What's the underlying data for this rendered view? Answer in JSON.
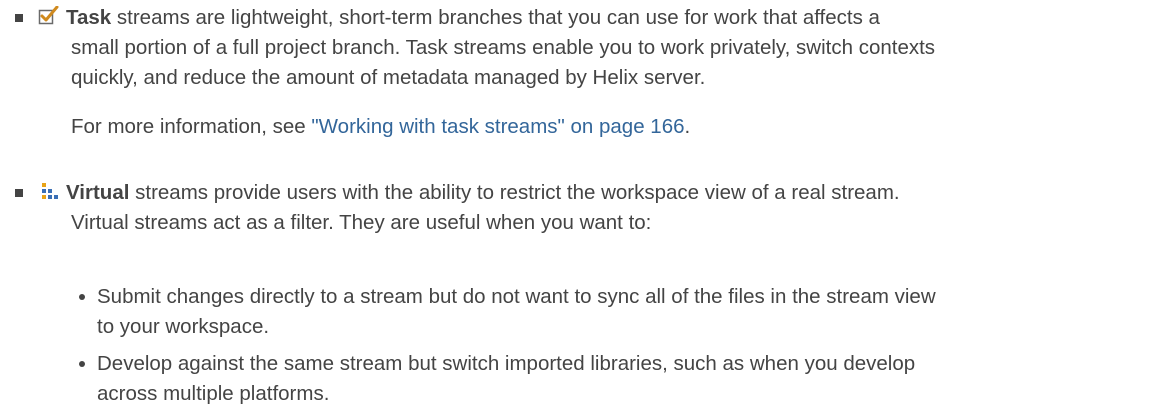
{
  "task": {
    "term": "Task",
    "line1_rest": " streams are lightweight, short-term branches that you can use for work that affects a",
    "line2": "small portion of a full project branch. Task streams enable you to work privately, switch contexts",
    "line3": "quickly, and reduce the amount of metadata managed by Helix server.",
    "more_prefix": "For more information, see ",
    "more_link": "\"Working with task streams\" on page 166",
    "more_suffix": ".",
    "icon": "task-stream-checkbox-icon",
    "icon_color": "#d08a1e"
  },
  "virtual": {
    "term": "Virtual",
    "line1_rest": " streams provide users with the ability to restrict the workspace view of a real stream.",
    "line2": "Virtual streams act as a filter. They are useful when you want to:",
    "icon": "virtual-stream-icon",
    "icon_colors": [
      "#e8a317",
      "#3a6fb5"
    ]
  },
  "subitems": [
    {
      "line1": "Submit changes directly to a stream but do not want to sync all of the files in the stream view",
      "line2": "to your workspace."
    },
    {
      "line1": "Develop against the same stream but switch imported libraries, such as when you develop",
      "line2": "across multiple platforms."
    }
  ],
  "colors": {
    "text": "#444444",
    "link": "#33669a"
  }
}
